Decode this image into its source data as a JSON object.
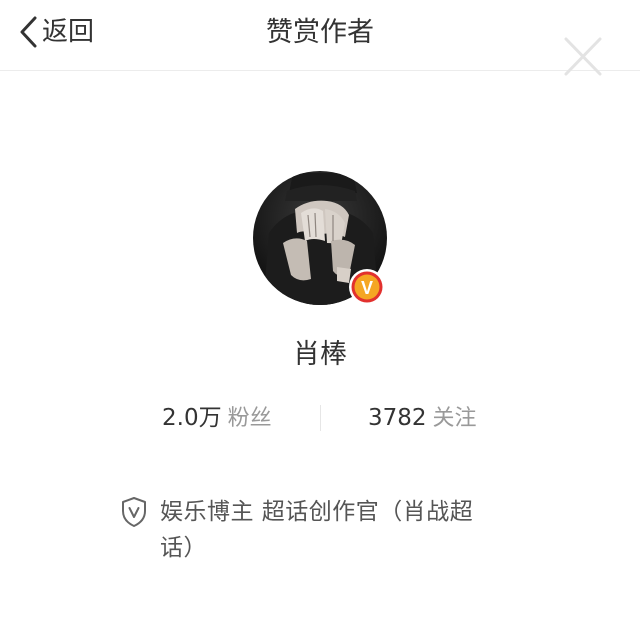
{
  "header": {
    "back_label": "返回",
    "title": "赞赏作者"
  },
  "profile": {
    "name": "肖棒",
    "verified_badge": "V",
    "stats": {
      "fans_value": "2.0万",
      "fans_label": "粉丝",
      "follow_value": "3782",
      "follow_label": "关注"
    },
    "verification_text": "娱乐博主 超话创作官（肖战超话）"
  },
  "icons": {
    "back": "chevron-left-icon",
    "close": "close-icon",
    "shield": "shield-v-icon"
  },
  "colors": {
    "accent_badge": "#f5a623",
    "badge_ring": "#e2312e",
    "divider": "#ececec",
    "muted_text": "#999999"
  }
}
